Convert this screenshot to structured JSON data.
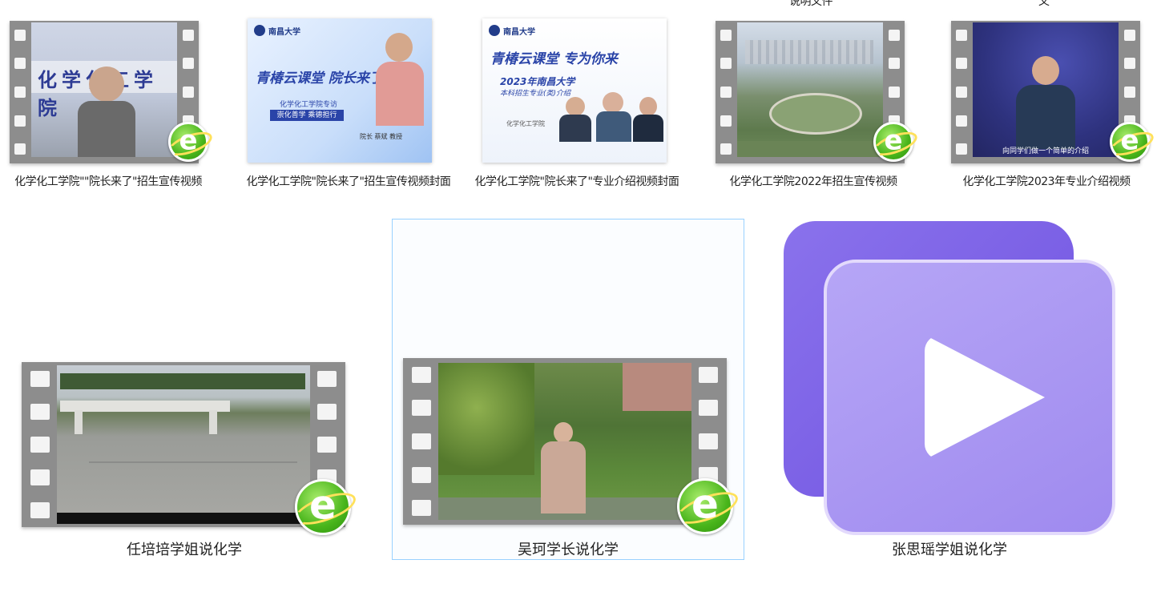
{
  "items_top": [
    {
      "label": "化学化工学院\"\"院长来了\"招生宣传视频",
      "kind": "video"
    },
    {
      "label": "化学化工学院\"院长来了\"招生宣传视频封面",
      "kind": "image",
      "thumb": {
        "logo": "南昌大学",
        "slogan": "青椿云课堂 院长来了",
        "sub1": "化学化工学院专访",
        "sub2": "崇化善学 乘德担行",
        "caption": "院长 蔡斌 教授"
      }
    },
    {
      "label": "化学化工学院\"院长来了\"专业介绍视频封面",
      "kind": "image",
      "thumb": {
        "logo": "南昌大学",
        "slogan": "青椿云课堂 专为你来",
        "title": "2023年南昌大学",
        "subtitle": "本科招生专业(类)介绍",
        "dept": "化学化工学院"
      }
    },
    {
      "label": "化学化工学院2022年招生宣传视频",
      "kind": "video"
    },
    {
      "label": "化学化工学院2023年专业介绍视频",
      "kind": "video",
      "subtitle": "向同学们做一个简单的介绍"
    }
  ],
  "items_bottom": [
    {
      "label": "任培培学姐说化学",
      "kind": "video"
    },
    {
      "label": "吴珂学长说化学",
      "kind": "video",
      "selected": true
    },
    {
      "label": "张思瑶学姐说化学",
      "kind": "video-app"
    }
  ],
  "cut_off_top": {
    "left": "说明文件",
    "right": "文"
  },
  "icons": {
    "film": "film-strip-icon",
    "browser": "browser-e-icon",
    "player": "video-player-icon"
  },
  "colors": {
    "selection_border": "#99d1ff",
    "player_back": "#7e62e8",
    "player_front": "#a995f2"
  }
}
